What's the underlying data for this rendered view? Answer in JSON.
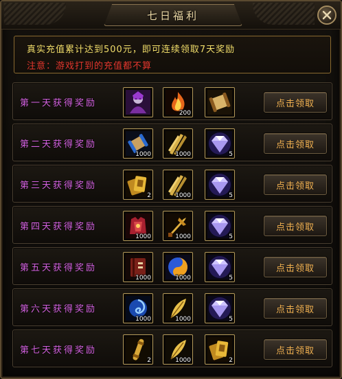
{
  "window": {
    "title": "七日福利"
  },
  "notice": {
    "line1": "真实充值累计达到500元，即可连续领取7天奖励",
    "line2": "注意：游戏打到的充值都不算"
  },
  "colors": {
    "label_magenta": "#d462e0",
    "label_green": "#8fe06a",
    "button_text": "#f0b050",
    "notice_yellow": "#f1dd6a",
    "notice_red": "#e2362d"
  },
  "claim_label": "点击领取",
  "days": [
    {
      "label": "第一天获得奖励",
      "items": [
        {
          "icon": "sorceress-portrait-icon",
          "qty": ""
        },
        {
          "icon": "flame-icon",
          "qty": "200"
        },
        {
          "icon": "scroll-icon",
          "qty": ""
        }
      ]
    },
    {
      "label": "第二天获得奖励",
      "items": [
        {
          "icon": "blue-scroll-icon",
          "qty": "1000"
        },
        {
          "icon": "golden-feathers-icon",
          "qty": "1000"
        },
        {
          "icon": "purple-diamond-icon",
          "qty": "5"
        }
      ]
    },
    {
      "label": "第三天获得奖励",
      "items": [
        {
          "icon": "golden-cards-icon",
          "qty": "2"
        },
        {
          "icon": "golden-feathers-icon",
          "qty": "1000"
        },
        {
          "icon": "purple-diamond-icon",
          "qty": "5"
        }
      ]
    },
    {
      "label": "第四天获得奖励",
      "items": [
        {
          "icon": "red-armor-icon",
          "qty": "1000"
        },
        {
          "icon": "golden-weapon-icon",
          "qty": "1000"
        },
        {
          "icon": "purple-diamond-icon",
          "qty": "5"
        }
      ]
    },
    {
      "label": "第五天获得奖励",
      "items": [
        {
          "icon": "book-icon",
          "qty": "1000"
        },
        {
          "icon": "yin-yang-icon",
          "qty": "1000"
        },
        {
          "icon": "purple-diamond-icon",
          "qty": "5"
        }
      ]
    },
    {
      "label": "第六天获得奖励",
      "items": [
        {
          "icon": "blue-vortex-icon",
          "qty": "1000"
        },
        {
          "icon": "golden-feather-icon",
          "qty": "1000"
        },
        {
          "icon": "purple-diamond-icon",
          "qty": "5"
        }
      ]
    },
    {
      "label": "第七天获得奖励",
      "items": [
        {
          "icon": "golden-rod-icon",
          "qty": "2"
        },
        {
          "icon": "golden-feather-icon",
          "qty": "1000"
        },
        {
          "icon": "golden-cards-icon",
          "qty": "2"
        }
      ]
    }
  ]
}
